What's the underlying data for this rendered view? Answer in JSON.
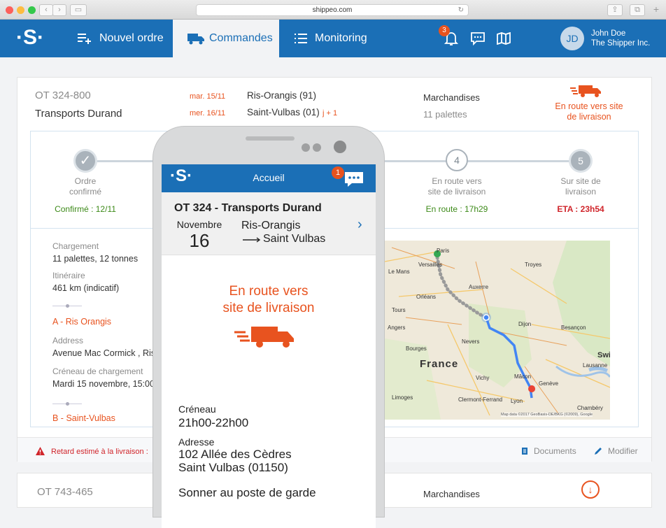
{
  "browser": {
    "url": "shippeo.com"
  },
  "nav": {
    "logo": "·S·",
    "items": [
      {
        "label": "Nouvel ordre",
        "icon": "add-list-icon"
      },
      {
        "label": "Commandes",
        "icon": "truck-icon",
        "active": true
      },
      {
        "label": "Monitoring",
        "icon": "list-icon"
      }
    ],
    "notification_count": "3",
    "user": {
      "initials": "JD",
      "name": "John Doe",
      "company": "The Shipper Inc."
    }
  },
  "order": {
    "id": "OT 324-800",
    "carrier": "Transports Durand",
    "dates": [
      {
        "date": "mar. 15/11",
        "place": "Ris-Orangis (91)",
        "extra": ""
      },
      {
        "date": "mer. 16/11",
        "place": "Saint-Vulbas (01)",
        "extra": "j + 1"
      }
    ],
    "goods_label": "Marchandises",
    "goods_value": "11 palettes",
    "status": "En route vers site de livraison",
    "status_line1": "En route vers site",
    "status_line2": "de livraison",
    "steps": [
      {
        "n": "✓",
        "l1": "Ordre",
        "l2": "confirmé",
        "status": "Confirmé : 12/11",
        "color": "#3d8a19"
      },
      {
        "n": "4",
        "l1": "En route vers",
        "l2": "site de livraison",
        "status": "En route : 17h29",
        "color": "#3d8a19"
      },
      {
        "n": "5",
        "l1": "Sur site de",
        "l2": "livraison",
        "status": "ETA : 23h54",
        "color": "#d0252b"
      }
    ],
    "details": {
      "loading_label": "Chargement",
      "loading_value": "11 palettes, 12 tonnes",
      "route_label": "Itinéraire",
      "route_value": "461 km (indicatif)",
      "stop_a": "A - Ris Orangis",
      "address_label": "Address",
      "address_value": "Avenue Mac Cormick , Ris-",
      "slot_label": "Créneau de chargement",
      "slot_value": "Mardi 15 novembre, 15:00",
      "stop_b": "B - Saint-Vulbas"
    },
    "footer": {
      "delay": "Retard estimé à la livraison :",
      "documents": "Documents",
      "edit": "Modifier"
    }
  },
  "map": {
    "country": "France",
    "attribution": "Map data ©2017 GeoBasis-DE/BKG (©2009), Google",
    "cities": [
      "Paris",
      "Versailles",
      "Orléans",
      "Dijon",
      "Auxerre",
      "Besançon",
      "Lausanne",
      "Genève",
      "Lyon",
      "Mâcon",
      "Clermont-Ferrand",
      "Troyes",
      "Bourges",
      "Limoges",
      "Chambéry",
      "Swi",
      "Le Mans",
      "Tours",
      "Angers",
      "Vichy",
      "Nevers"
    ]
  },
  "next_order": {
    "id": "OT 743-465",
    "goods_label": "Marchandises"
  },
  "phone": {
    "header": "Accueil",
    "badge": "1",
    "title": "OT 324 - Transports Durand",
    "month": "Novembre",
    "day": "16",
    "from": "Ris-Orangis",
    "to": "Saint Vulbas",
    "status_line1": "En route vers",
    "status_line2": "site de livraison",
    "slot_label": "Créneau",
    "slot_value": "21h00-22h00",
    "address_label": "Adresse",
    "address_line1": "102 Allée des Cèdres",
    "address_line2": "Saint Vulbas (01150)",
    "note": "Sonner au poste de garde"
  },
  "colors": {
    "brand": "#1b6fb6",
    "accent": "#e8531f",
    "ok": "#3d8a19",
    "alert": "#d0252b"
  }
}
